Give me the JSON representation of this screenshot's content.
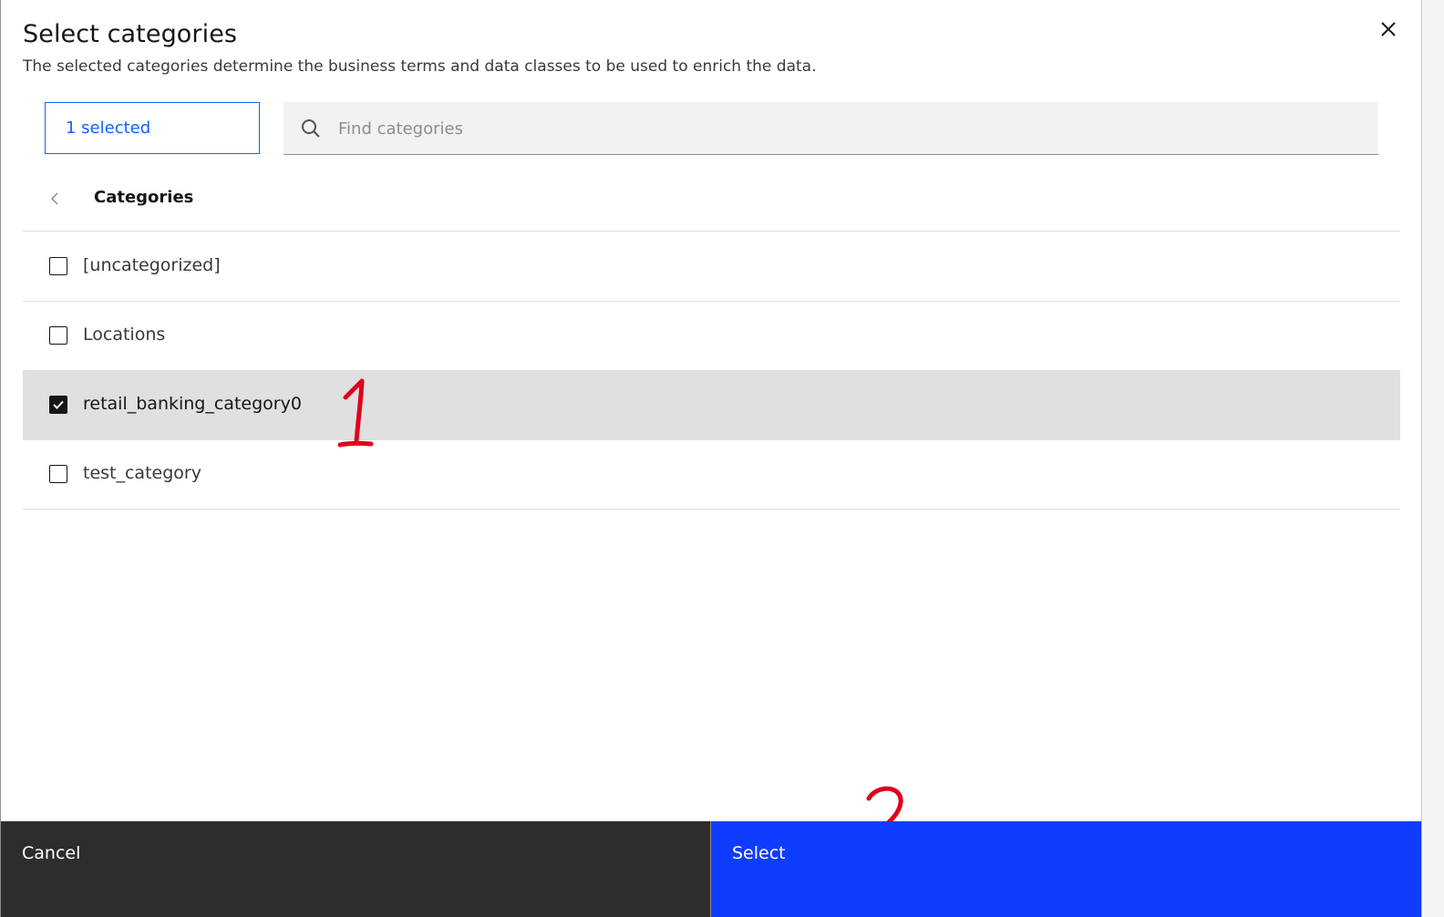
{
  "dialog": {
    "title": "Select categories",
    "subtitle": "The selected categories determine the business terms and data classes to be used to enrich the data.",
    "close_icon": "close-icon"
  },
  "selection": {
    "tag_label": "1 selected"
  },
  "search": {
    "placeholder": "Find categories",
    "value": "",
    "icon": "search-icon"
  },
  "breadcrumb": {
    "back_icon": "chevron-left-icon",
    "label": "Categories"
  },
  "categories": [
    {
      "label": "[uncategorized]",
      "checked": false
    },
    {
      "label": "Locations",
      "checked": false
    },
    {
      "label": "retail_banking_category0",
      "checked": true
    },
    {
      "label": "test_category",
      "checked": false
    }
  ],
  "annotations": [
    {
      "label": "1",
      "color": "#e0001b"
    },
    {
      "label": "2",
      "color": "#e0001b"
    }
  ],
  "footer": {
    "cancel_label": "Cancel",
    "select_label": "Select"
  },
  "colors": {
    "primary": "#0f3dff",
    "secondary": "#2d2d2d",
    "selected_row": "#e0e0e0",
    "annotation": "#e0001b"
  }
}
